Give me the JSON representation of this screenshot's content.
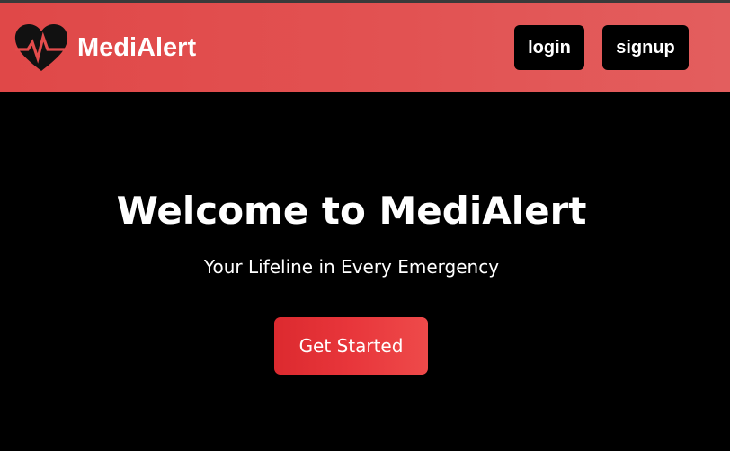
{
  "header": {
    "brand_name": "MediAlert",
    "brand_icon": "heart-pulse-icon",
    "nav": {
      "login_label": "login",
      "signup_label": "signup"
    }
  },
  "hero": {
    "title": "Welcome to MediAlert",
    "subtitle": "Your Lifeline in Every Emergency",
    "cta_label": "Get Started"
  },
  "colors": {
    "header_gradient_start": "#e04848",
    "header_gradient_end": "#e35e5e",
    "background": "#000000",
    "nav_button_bg": "#000000",
    "cta_gradient_start": "#dc2a2f",
    "cta_gradient_end": "#ee4a4a",
    "text": "#ffffff"
  }
}
